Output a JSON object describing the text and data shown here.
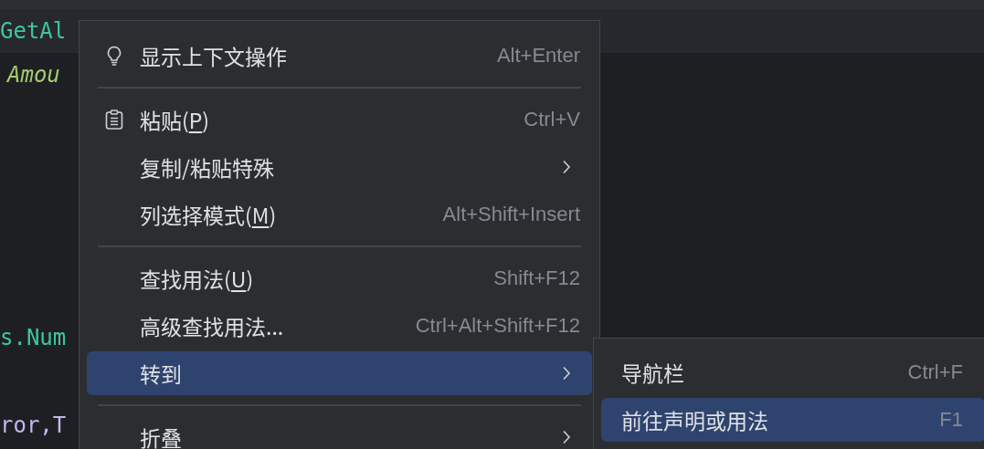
{
  "editor": {
    "lines": [
      {
        "text": "GetAl",
        "kind": "method",
        "current": true
      },
      {
        "text": "Amou",
        "kind": "field",
        "current": false
      },
      {
        "text": "s.Num",
        "kind": "method",
        "current": false
      },
      {
        "text": "ror,T",
        "kind": "variable",
        "current": false
      }
    ]
  },
  "context_menu": {
    "items": [
      {
        "kind": "item",
        "label": "显示上下文操作",
        "shortcut": "Alt+Enter",
        "selected": false
      },
      {
        "kind": "separator"
      },
      {
        "kind": "item",
        "label": "粘贴(",
        "mnemonic": "P",
        "label_end": ")",
        "shortcut": "Ctrl+V",
        "selected": false
      },
      {
        "kind": "submenu",
        "label": "复制/粘贴特殊",
        "selected": false
      },
      {
        "kind": "item",
        "label": "列选择模式(",
        "mnemonic": "M",
        "label_end": ")",
        "shortcut": "Alt+Shift+Insert",
        "selected": false
      },
      {
        "kind": "separator"
      },
      {
        "kind": "item",
        "label": "查找用法(",
        "mnemonic": "U",
        "label_end": ")",
        "shortcut": "Shift+F12",
        "selected": false
      },
      {
        "kind": "item",
        "label": "高级查找用法...",
        "shortcut": "Ctrl+Alt+Shift+F12",
        "selected": false
      },
      {
        "kind": "submenu",
        "label": "转到",
        "selected": true
      },
      {
        "kind": "separator"
      },
      {
        "kind": "submenu",
        "label": "折叠",
        "selected": false
      }
    ]
  },
  "submenu": {
    "items": [
      {
        "kind": "item",
        "label": "导航栏",
        "shortcut": "Ctrl+F",
        "selected": false
      },
      {
        "kind": "item",
        "label": "前往声明或用法",
        "shortcut": "F1",
        "selected": true
      }
    ]
  }
}
